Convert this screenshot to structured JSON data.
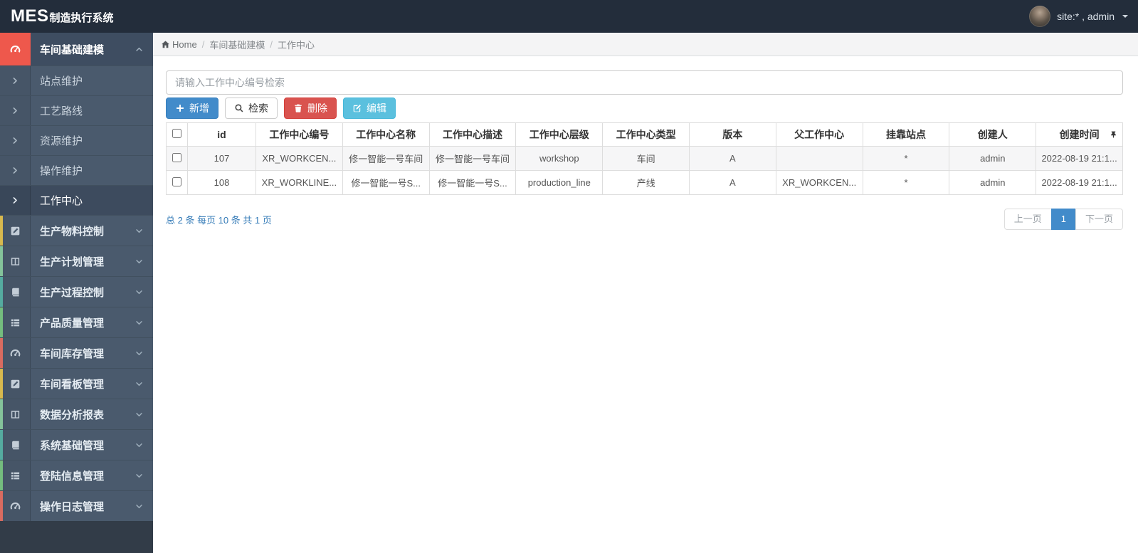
{
  "topbar": {
    "brand_mes": "MES",
    "brand_suffix": "制造执行系统",
    "user": "site:* , admin"
  },
  "sidebar": {
    "active_group": {
      "key": "workshop-basic-modeling",
      "label": "车间基础建模",
      "icon": "tachometer-icon"
    },
    "sub_items": [
      {
        "key": "site-maintenance",
        "label": "站点维护",
        "active": false
      },
      {
        "key": "process-route",
        "label": "工艺路线",
        "active": false
      },
      {
        "key": "resource-maintenance",
        "label": "资源维护",
        "active": false
      },
      {
        "key": "operation-maintenance",
        "label": "操作维护",
        "active": false
      },
      {
        "key": "work-center",
        "label": "工作中心",
        "active": true
      }
    ],
    "groups": [
      {
        "key": "production-material-control",
        "label": "生产物料控制",
        "icon": "pencil-square-icon",
        "strip": "#d8b94e"
      },
      {
        "key": "production-plan-management",
        "label": "生产计划管理",
        "icon": "columns-icon",
        "strip": "#84c39a"
      },
      {
        "key": "production-process-control",
        "label": "生产过程控制",
        "icon": "book-icon",
        "strip": "#55ab9f"
      },
      {
        "key": "product-quality-management",
        "label": "产品质量管理",
        "icon": "th-list-icon",
        "strip": "#74bd7e"
      },
      {
        "key": "workshop-inventory-management",
        "label": "车间库存管理",
        "icon": "tachometer-icon",
        "strip": "#d96b60"
      },
      {
        "key": "workshop-kanban-management",
        "label": "车间看板管理",
        "icon": "pencil-square-icon",
        "strip": "#d8b94e"
      },
      {
        "key": "data-analysis-report",
        "label": "数据分析报表",
        "icon": "columns-icon",
        "strip": "#84c39a"
      },
      {
        "key": "system-basic-management",
        "label": "系统基础管理",
        "icon": "book-icon",
        "strip": "#55ab9f"
      },
      {
        "key": "login-info-management",
        "label": "登陆信息管理",
        "icon": "th-list-icon",
        "strip": "#74bd7e"
      },
      {
        "key": "operation-log-management",
        "label": "操作日志管理",
        "icon": "tachometer-icon",
        "strip": "#d96b60"
      }
    ]
  },
  "breadcrumb": {
    "home": "Home",
    "path": [
      "车间基础建模",
      "工作中心"
    ]
  },
  "toolbar": {
    "search_placeholder": "请输入工作中心编号检索",
    "add_label": "新增",
    "search_label": "检索",
    "delete_label": "删除",
    "edit_label": "编辑"
  },
  "table": {
    "columns": [
      "id",
      "工作中心编号",
      "工作中心名称",
      "工作中心描述",
      "工作中心层级",
      "工作中心类型",
      "版本",
      "父工作中心",
      "挂靠站点",
      "创建人",
      "创建时间"
    ],
    "rows": [
      [
        "107",
        "XR_WORKCEN...",
        "修一智能一号车间",
        "修一智能一号车间",
        "workshop",
        "车间",
        "A",
        "",
        "*",
        "admin",
        "2022-08-19 21:1..."
      ],
      [
        "108",
        "XR_WORKLINE...",
        "修一智能一号S...",
        "修一智能一号S...",
        "production_line",
        "产线",
        "A",
        "XR_WORKCEN...",
        "*",
        "admin",
        "2022-08-19 21:1..."
      ]
    ]
  },
  "pagination": {
    "summary": "总 2 条 每页 10 条 共 1 页",
    "prev": "上一页",
    "page": "1",
    "next": "下一页"
  },
  "colors": {
    "topbar": "#232d3b",
    "sidebar_item": "#4a5a6d",
    "sidebar_active": "#3e4d61",
    "accent_red": "#ee584c",
    "primary": "#428bca",
    "danger": "#d9534f",
    "info": "#5bc0de",
    "link_blue": "#337ab7"
  }
}
